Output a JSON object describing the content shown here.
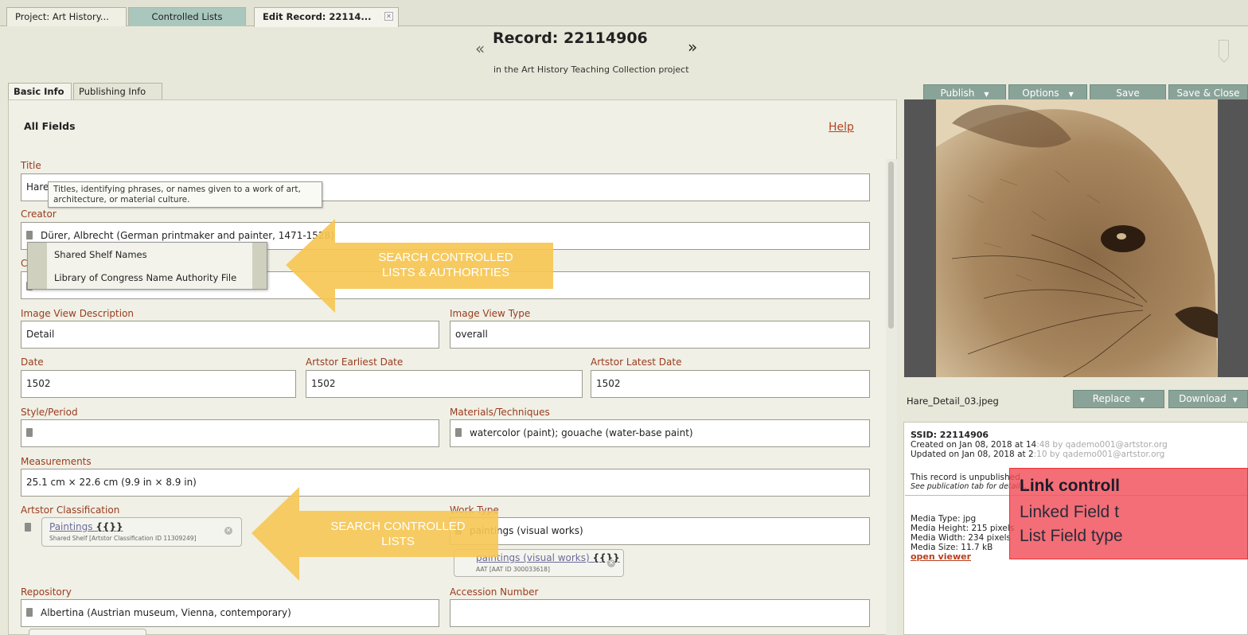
{
  "tabs": [
    {
      "label": "Project: Art History..."
    },
    {
      "label": "Controlled Lists"
    },
    {
      "label": "Edit Record: 22114..."
    }
  ],
  "header": {
    "title": "Record: 22114906",
    "subtitle": "in the Art History Teaching Collection project",
    "prev": "«",
    "next": "»"
  },
  "subtabs": [
    {
      "label": "Basic Info"
    },
    {
      "label": "Publishing Info"
    }
  ],
  "toolbar": {
    "publish": "Publish",
    "options": "Options",
    "save": "Save",
    "save_close": "Save & Close"
  },
  "form": {
    "heading": "All Fields",
    "help": "Help",
    "title_label": "Title",
    "title_value": "Hare (",
    "tooltip": "Titles, identifying phrases, or names given to a work of art, architecture, or material culture.",
    "creator_label": "Creator",
    "creator_value": "Dürer, Albrecht (German printmaker and painter, 1471-1528)",
    "culture_label": "C",
    "authority_options": [
      "Shared Shelf Names",
      "Library of Congress Name Authority File"
    ],
    "image_view_desc_label": "Image View Description",
    "image_view_desc_value": "Detail",
    "image_view_type_label": "Image View Type",
    "image_view_type_value": "overall",
    "date_label": "Date",
    "date_value": "1502",
    "earliest_label": "Artstor Earliest Date",
    "earliest_value": "1502",
    "latest_label": "Artstor Latest Date",
    "latest_value": "1502",
    "style_label": "Style/Period",
    "materials_label": "Materials/Techniques",
    "materials_value": "watercolor (paint); gouache (water-base paint)",
    "measurements_label": "Measurements",
    "measurements_value": "25.1 cm × 22.6 cm (9.9 in × 8.9 in)",
    "classification_label": "Artstor Classification",
    "classification_chip": "Paintings",
    "classification_chip_sub": "Shared Shelf [Artstor Classification ID 11309249]",
    "work_type_label": "Work Type",
    "work_type_value": "paintings (visual works)",
    "work_type_chip": "paintings (visual works)",
    "work_type_chip_sub": "AAT [AAT ID 300033618]",
    "repository_label": "Repository",
    "repository_value": "Albertina (Austrian museum, Vienna, contemporary)",
    "accession_label": "Accession Number"
  },
  "callouts": {
    "authorities": [
      "SEARCH CONTROLLED",
      "LISTS & AUTHORITIES"
    ],
    "lists": [
      "SEARCH CONTROLLED",
      "LISTS"
    ]
  },
  "media": {
    "file_name": "Hare_Detail_03.jpeg",
    "replace": "Replace",
    "download": "Download"
  },
  "record_info": {
    "ssid": "SSID: 22114906",
    "created": "Created on Jan 08, 2018 at 14",
    "created_faint": ":48 by qademo001@artstor.org",
    "updated": "Updated on Jan 08, 2018 at 2",
    "updated_faint": ":10 by qademo001@artstor.org",
    "unpublished": "This record is unpublished.",
    "unpublished_note": "See publication tab for details.",
    "media_type": "Media Type: jpg",
    "media_height": "Media Height: 215 pixels",
    "media_width": "Media Width: 234 pixels",
    "media_size": "Media Size: 11.7 kB",
    "open_viewer": "open viewer"
  },
  "note": {
    "line1": "Link controll",
    "line2": "Linked Field t",
    "line3": "List Field type"
  },
  "colors": {
    "accent_button": "#8aa398",
    "label": "#9a3b1e",
    "callout": "#f6c754",
    "note": "#f04e58"
  }
}
